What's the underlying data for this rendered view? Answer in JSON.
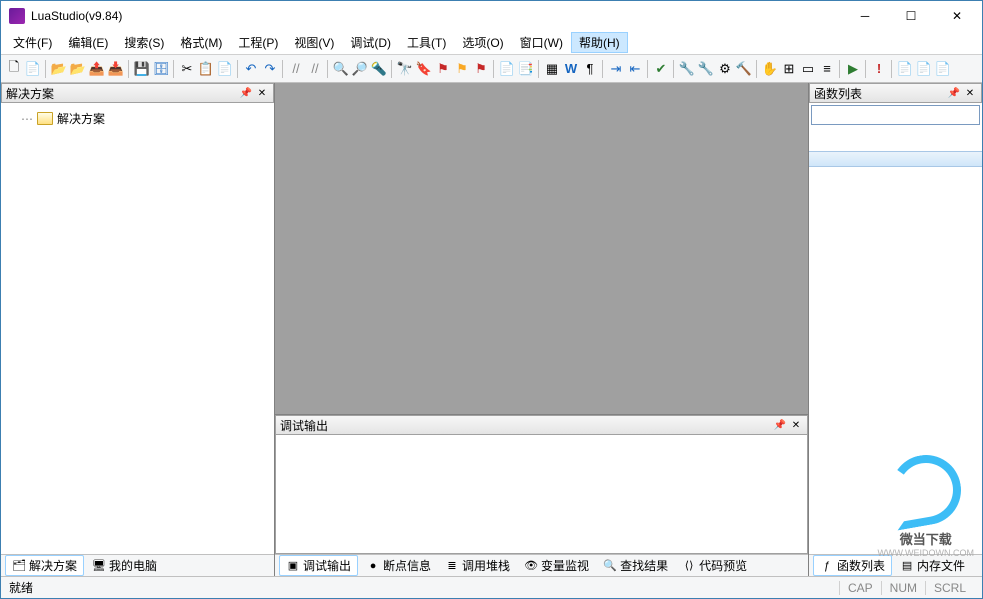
{
  "window": {
    "title": "LuaStudio(v9.84)"
  },
  "menu": {
    "file": "文件(F)",
    "edit": "编辑(E)",
    "search": "搜索(S)",
    "format": "格式(M)",
    "project": "工程(P)",
    "view": "视图(V)",
    "debug": "调试(D)",
    "tools": "工具(T)",
    "options": "选项(O)",
    "window": "窗口(W)",
    "help": "帮助(H)"
  },
  "panels": {
    "solution": {
      "title": "解决方案",
      "root": "解决方案"
    },
    "functions": {
      "title": "函数列表",
      "search_placeholder": ""
    },
    "debug_output": {
      "title": "调试输出"
    }
  },
  "bottom_tabs_left": {
    "solution": "解决方案",
    "computer": "我的电脑"
  },
  "bottom_tabs_center": {
    "debug_output": "调试输出",
    "breakpoints": "断点信息",
    "call_stack": "调用堆栈",
    "watch": "变量监视",
    "find_results": "查找结果",
    "code_preview": "代码预览"
  },
  "bottom_tabs_right": {
    "functions": "函数列表",
    "memory": "内存文件"
  },
  "status": {
    "ready": "就绪",
    "cap": "CAP",
    "num": "NUM",
    "scrl": "SCRL"
  },
  "watermark": {
    "text": "微当下载",
    "url": "WWW.WEIDOWN.COM"
  },
  "icons": {
    "new": "🗋",
    "newproj": "📄",
    "open": "📂",
    "openproj": "📂",
    "export": "📤",
    "import": "📥",
    "save": "💾",
    "saveall": "🗄",
    "cut": "✂",
    "copy": "📋",
    "paste": "📄",
    "undo": "↶",
    "redo": "↷",
    "comment": "//",
    "uncomment": "//",
    "find": "🔍",
    "replace": "🔎",
    "findinfiles": "🔦",
    "bookmark": "🔖",
    "nextbm": "▶",
    "prevbm": "◀",
    "block": "▦",
    "word": "W",
    "para": "¶",
    "indent": "⇥",
    "outdent": "⇤",
    "check": "✔",
    "config": "🔧",
    "wrench": "🔧",
    "gear": "⚙",
    "hand": "✋",
    "grid": "⊞",
    "form": "▭",
    "list": "≡",
    "run": "▶",
    "stop": "!",
    "doc1": "📄",
    "doc2": "📄",
    "doc3": "📄"
  }
}
